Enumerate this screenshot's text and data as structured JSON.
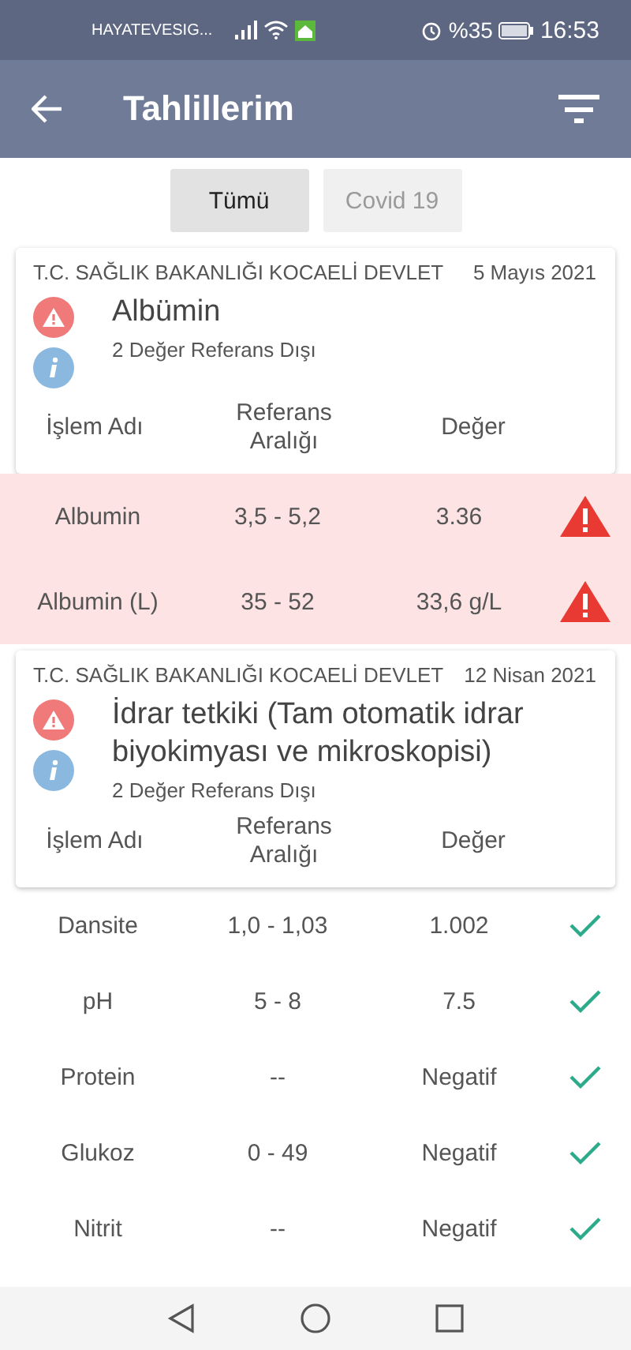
{
  "status_bar": {
    "carrier": "HAYATEVESIG...",
    "battery": "%35",
    "time": "16:53"
  },
  "app_bar": {
    "title": "Tahlillerim"
  },
  "tabs": [
    {
      "label": "Tümü",
      "selected": true
    },
    {
      "label": "Covid 19",
      "selected": false
    }
  ],
  "results": [
    {
      "institution": "T.C. SAĞLIK BAKANLIĞI KOCAELİ DEVLET",
      "date": "5 Mayıs 2021",
      "test": "Albümin",
      "note": "2 Değer Referans Dışı",
      "columns": [
        "İşlem Adı",
        "Referans Aralığı",
        "Değer"
      ],
      "rows": [
        {
          "name": "Albumin",
          "range": "3,5 - 5,2",
          "value": "3.36",
          "out_of_range": true
        },
        {
          "name": "Albumin (L)",
          "range": "35 - 52",
          "value": "33,6 g/L",
          "out_of_range": true
        }
      ]
    },
    {
      "institution": "T.C. SAĞLIK BAKANLIĞI KOCAELİ DEVLET",
      "date": "12 Nisan 2021",
      "test": "İdrar tetkiki (Tam otomatik idrar biyokimyası ve mikroskopisi)",
      "note": "2 Değer Referans Dışı",
      "columns": [
        "İşlem Adı",
        "Referans Aralığı",
        "Değer"
      ],
      "rows": [
        {
          "name": "Dansite",
          "range": "1,0 - 1,03",
          "value": "1.002",
          "out_of_range": false
        },
        {
          "name": "pH",
          "range": "5 - 8",
          "value": "7.5",
          "out_of_range": false
        },
        {
          "name": "Protein",
          "range": "--",
          "value": "Negatif",
          "out_of_range": false
        },
        {
          "name": "Glukoz",
          "range": "0 - 49",
          "value": "Negatif",
          "out_of_range": false
        },
        {
          "name": "Nitrit",
          "range": "--",
          "value": "Negatif",
          "out_of_range": false
        }
      ]
    }
  ]
}
